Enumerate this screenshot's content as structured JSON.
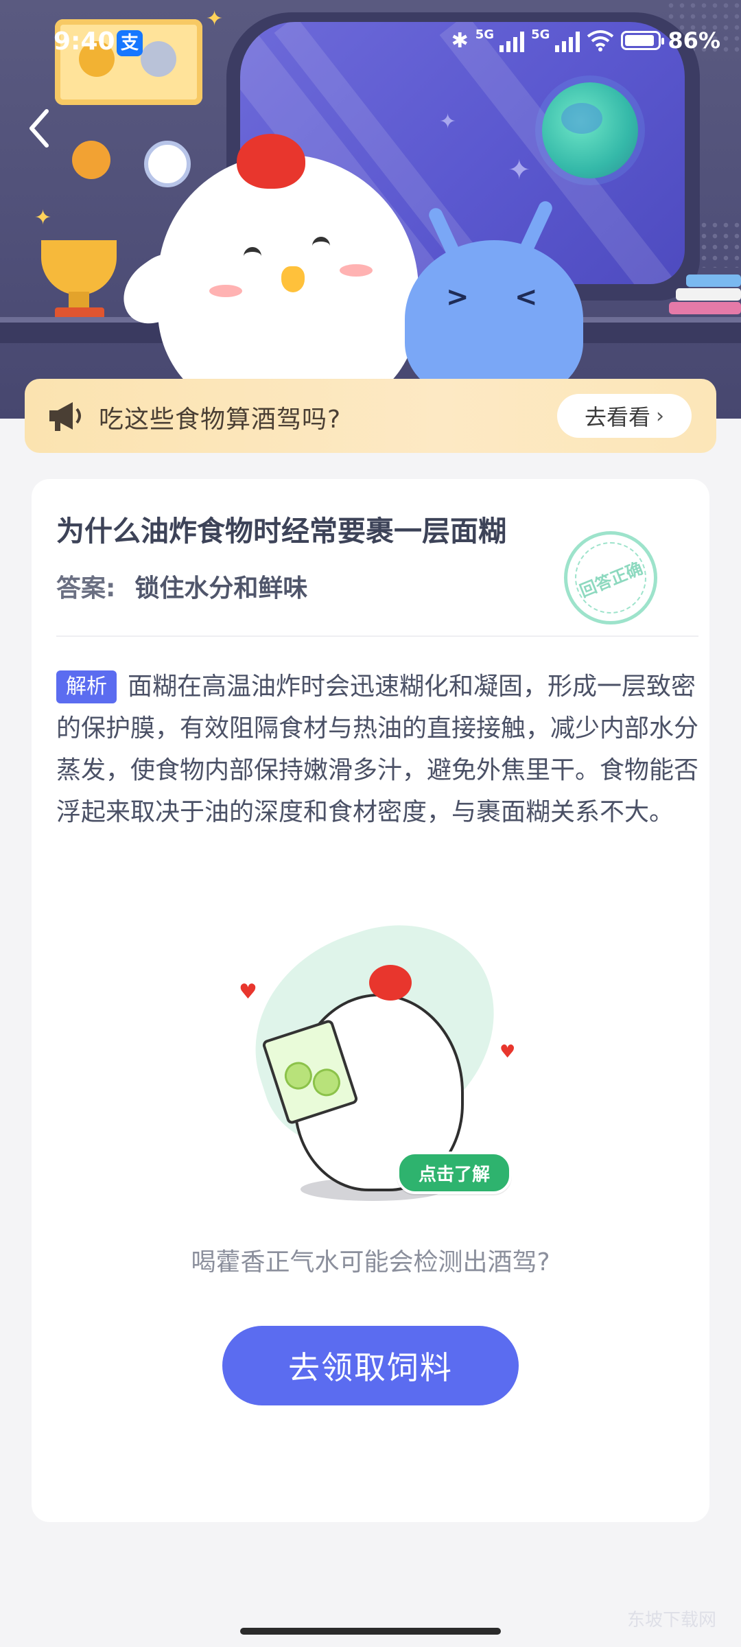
{
  "status_bar": {
    "time": "9:40",
    "alipay_icon": "支",
    "network_1": "5G",
    "network_2": "5G",
    "battery": "86%"
  },
  "banner": {
    "icon": "megaphone-icon",
    "text": "吃这些食物算酒驾吗?",
    "button": "去看看"
  },
  "card": {
    "question": "为什么油炸食物时经常要裹一层面糊",
    "answer_label": "答案:",
    "answer": "锁住水分和鲜味",
    "stamp": "回答正确",
    "tag": "解析",
    "explanation": "面糊在高温油炸时会迅速糊化和凝固，形成一层致密的保护膜，有效阻隔食材与热油的直接接触，减少内部水分蒸发，使食物内部保持嫩滑多汁，避免外焦里干。食物能否浮起来取决于油的深度和食材密度，与裹面糊关系不大。",
    "illustration_badge": "点击了解",
    "link_text": "喝藿香正气水可能会检测出酒驾?",
    "cta": "去领取饲料"
  },
  "watermark": "东坡下载网",
  "colors": {
    "primary": "#5b6cf0",
    "banner_bg": "#fbe3b0",
    "hero_bg": "#5a5a80",
    "stamp_green": "#9de3cb",
    "badge_green": "#2eb36e"
  }
}
